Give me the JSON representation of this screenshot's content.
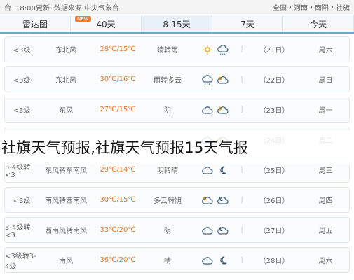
{
  "topbar": {
    "left": [
      "台",
      "18:00更新",
      "数据来源 中央气象台"
    ],
    "breadcrumb": [
      "全国",
      "河南",
      "南阳",
      "社旗"
    ]
  },
  "tabs": [
    {
      "label": "今天"
    },
    {
      "label": "7天"
    },
    {
      "label": "8-15天"
    },
    {
      "label": "40天",
      "badge": "NEW"
    },
    {
      "label": "雷达图"
    }
  ],
  "forecast": [
    {
      "day": "周六",
      "date": "（21日）",
      "weather": "晴转雨",
      "temp": "28℃/15℃",
      "dir": "东北风",
      "wind": "<3级",
      "icons": [
        "sun-icon",
        "cloud-rain-icon"
      ]
    },
    {
      "day": "周日",
      "date": "（22日）",
      "weather": "雨转多云",
      "temp": "30℃/16℃",
      "dir": "东北风",
      "wind": "<3级",
      "icons": [
        "cloud-rain-icon",
        "cloud-sun-icon"
      ]
    },
    {
      "day": "周一",
      "date": "（23日）",
      "weather": "阴",
      "temp": "27℃/15℃",
      "dir": "东风",
      "wind": "<3级",
      "icons": [
        "cloud-icon",
        "cloud-sun-icon"
      ]
    },
    {
      "day": "周二",
      "date": "（24日）",
      "weather": "",
      "temp": "",
      "dir": "",
      "wind": "",
      "icons": [
        "cloud-icon",
        "cloud-sun-icon"
      ]
    },
    {
      "day": "周三",
      "date": "（25日）",
      "weather": "阴转晴",
      "temp": "29℃/14℃",
      "dir": "东风转东南风",
      "wind": "3-4级转<3",
      "icons": [
        "cloud-icon",
        "moon-icon"
      ]
    },
    {
      "day": "周四",
      "date": "（26日）",
      "weather": "多云转阴",
      "temp": "30℃/15℃",
      "dir": "南风转西南风",
      "wind": "<3级",
      "icons": [
        "cloud-sun-icon",
        "cloud-moon-icon"
      ]
    },
    {
      "day": "周五",
      "date": "（27日）",
      "weather": "阴",
      "temp": "33℃/20℃",
      "dir": "西南风转南风",
      "wind": "3-4级转<3",
      "icons": [
        "cloud-icon",
        "cloud-moon-icon"
      ]
    },
    {
      "day": "周六",
      "date": "（28日）",
      "weather": "晴",
      "temp": "36℃/20℃",
      "dir": "南风",
      "wind": "<3级转3-4级",
      "icons": [
        "cloud-icon",
        "moon-icon"
      ]
    }
  ],
  "overlay_text": "社旗天气预报,社旗天气预报15天气报",
  "colors": {
    "tab_border": "#6aa8d8",
    "temp": "#e07a2e",
    "badge": "#ff7a2d"
  }
}
